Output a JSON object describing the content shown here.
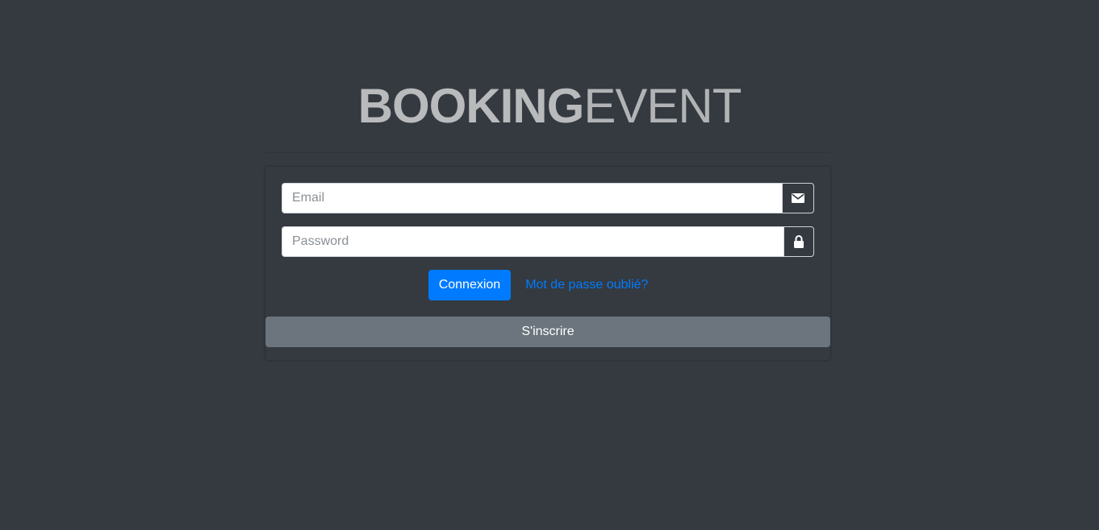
{
  "brand": {
    "bold": "BOOKING",
    "light": "EVENT",
    "color": "#b8babc"
  },
  "login_form": {
    "email": {
      "placeholder": "Email",
      "value": "",
      "icon": "envelope-icon"
    },
    "password": {
      "placeholder": "Password",
      "value": "",
      "icon": "lock-icon"
    },
    "submit_label": "Connexion",
    "forgot_label": "Mot de passe oublié?",
    "register_label": "S'inscrire"
  },
  "colors": {
    "background": "#343a40",
    "primary": "#007bff",
    "secondary": "#6c757d"
  }
}
